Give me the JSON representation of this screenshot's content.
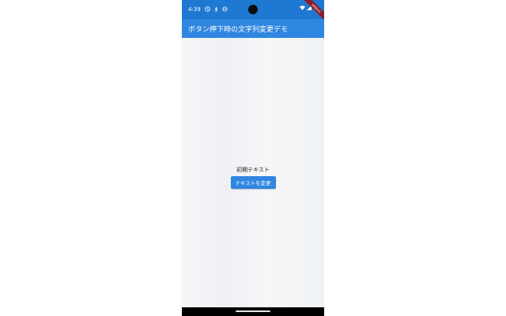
{
  "status_bar": {
    "time": "4:39",
    "icons": [
      "clock-icon",
      "download-icon",
      "app-icon"
    ],
    "right_icons": [
      "wifi-icon",
      "signal-icon",
      "battery-icon"
    ],
    "debug_banner": "DEBUG"
  },
  "app_bar": {
    "title": "ボタン押下時の文字列変更デモ"
  },
  "main": {
    "text": "初期テキスト",
    "button_label": "テキストを変更"
  },
  "colors": {
    "primary": "#2f86e0",
    "status_bar": "#1f78d1",
    "background": "#f2f4f6",
    "nav_bar": "#000000"
  }
}
